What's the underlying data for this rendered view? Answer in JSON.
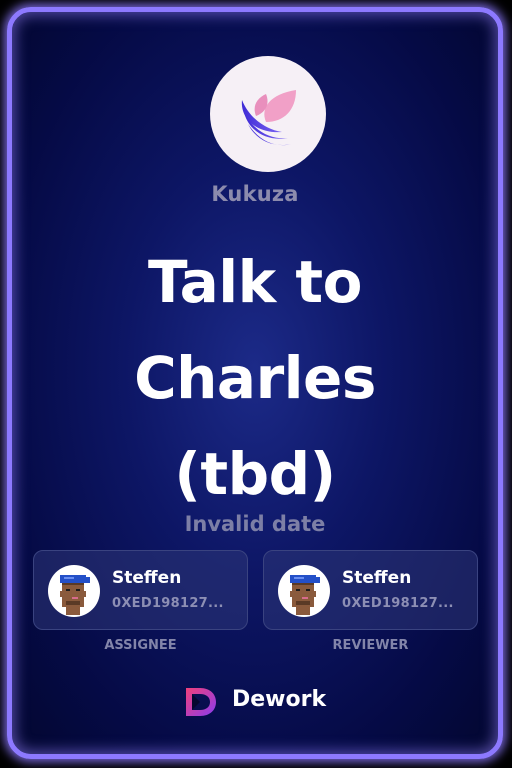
{
  "organization": {
    "logo_icon": "leaf-wave-logo-icon",
    "name": "Kukuza"
  },
  "task": {
    "title_lines": [
      "Talk to",
      "Charles",
      "(tbd)"
    ],
    "due_date": "Invalid date"
  },
  "assignee": {
    "avatar_icon": "pixel-punk-avatar-icon",
    "name": "Steffen",
    "address": "0XED198127...",
    "role_label": "ASSIGNEE"
  },
  "reviewer": {
    "avatar_icon": "pixel-punk-avatar-icon",
    "name": "Steffen",
    "address": "0XED198127...",
    "role_label": "REVIEWER"
  },
  "brand": {
    "logo_icon": "dework-logo-icon",
    "name": "Dework"
  },
  "colors": {
    "border_glow": "#8d79ff",
    "background": "#0d1665",
    "title_text": "#ffffff",
    "muted_text": "#8c8bad"
  }
}
